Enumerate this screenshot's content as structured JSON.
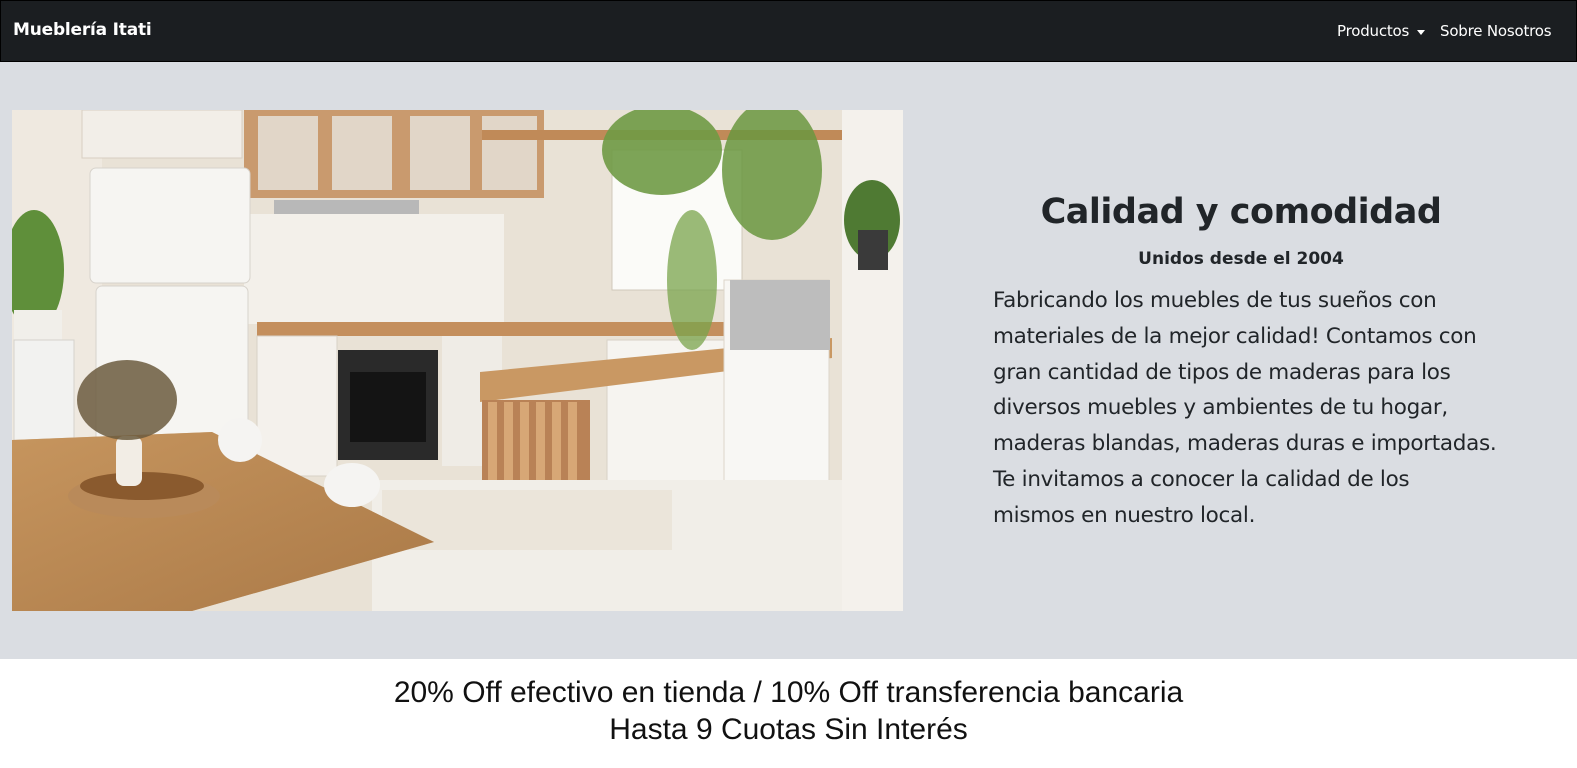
{
  "navbar": {
    "brand": "Mueblería Itati",
    "links": [
      {
        "label": "Productos",
        "has_dropdown": true
      },
      {
        "label": "Sobre Nosotros",
        "has_dropdown": false
      }
    ],
    "background": "#1b1e21"
  },
  "hero": {
    "background": "#dadde2",
    "image_alt": "kitchen-interior-photo",
    "title": "Calidad y comodidad",
    "subtitle": "Unidos desde el 2004",
    "body_lines": [
      "Fabricando los muebles de tus sueños con",
      "materiales de la mejor calidad! Contamos con",
      "gran cantidad de tipos de maderas para los",
      "diversos muebles y ambientes de tu hogar,",
      "maderas blandas, maderas duras e importadas.",
      "Te invitamos a conocer la calidad de los",
      "mismos en nuestro local."
    ]
  },
  "promo": {
    "line1": "20% Off efectivo en tienda / 10% Off transferencia bancaria",
    "line2": "Hasta 9 Cuotas Sin Interés"
  }
}
